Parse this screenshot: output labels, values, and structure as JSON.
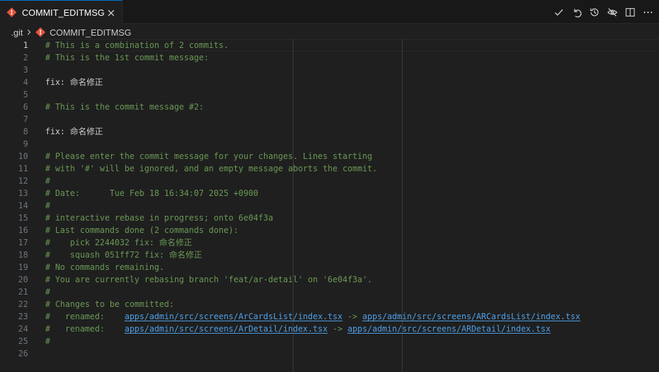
{
  "tab": {
    "title": "COMMIT_EDITMSG"
  },
  "breadcrumb": {
    "folder": ".git",
    "file": "COMMIT_EDITMSG"
  },
  "colors": {
    "accent": "#0078d4",
    "comment": "#6a9955",
    "link": "#4da0e8",
    "git": "#e5533c"
  },
  "actions": [
    {
      "icon": "check-icon"
    },
    {
      "icon": "undo-icon"
    },
    {
      "icon": "history-icon"
    },
    {
      "icon": "eye-closed-icon"
    },
    {
      "icon": "split-editor-icon"
    },
    {
      "icon": "more-icon"
    }
  ],
  "editor": {
    "lines": [
      {
        "num": "1",
        "text": "# This is a combination of 2 commits.",
        "kind": "comment"
      },
      {
        "num": "2",
        "text": "# This is the 1st commit message:",
        "kind": "comment"
      },
      {
        "num": "3",
        "text": "",
        "kind": "plain"
      },
      {
        "num": "4",
        "text": "fix: 命名修正",
        "kind": "plain"
      },
      {
        "num": "5",
        "text": "",
        "kind": "plain"
      },
      {
        "num": "6",
        "text": "# This is the commit message #2:",
        "kind": "comment"
      },
      {
        "num": "7",
        "text": "",
        "kind": "plain"
      },
      {
        "num": "8",
        "text": "fix: 命名修正",
        "kind": "plain"
      },
      {
        "num": "9",
        "text": "",
        "kind": "plain"
      },
      {
        "num": "10",
        "text": "# Please enter the commit message for your changes. Lines starting",
        "kind": "comment"
      },
      {
        "num": "11",
        "text": "# with '#' will be ignored, and an empty message aborts the commit.",
        "kind": "comment"
      },
      {
        "num": "12",
        "text": "#",
        "kind": "comment"
      },
      {
        "num": "13",
        "text": "# Date:      Tue Feb 18 16:34:07 2025 +0900",
        "kind": "comment"
      },
      {
        "num": "14",
        "text": "#",
        "kind": "comment"
      },
      {
        "num": "15",
        "text": "# interactive rebase in progress; onto 6e04f3a",
        "kind": "comment"
      },
      {
        "num": "16",
        "text": "# Last commands done (2 commands done):",
        "kind": "comment"
      },
      {
        "num": "17",
        "text": "#    pick 2244032 fix: 命名修正",
        "kind": "comment"
      },
      {
        "num": "18",
        "text": "#    squash 051ff72 fix: 命名修正",
        "kind": "comment"
      },
      {
        "num": "19",
        "text": "# No commands remaining.",
        "kind": "comment"
      },
      {
        "num": "20",
        "text": "# You are currently rebasing branch 'feat/ar-detail' on '6e04f3a'.",
        "kind": "comment"
      },
      {
        "num": "21",
        "text": "#",
        "kind": "comment"
      },
      {
        "num": "22",
        "text": "# Changes to be committed:",
        "kind": "comment"
      },
      {
        "num": "23",
        "kind": "rename",
        "prefix": "#   renamed:    ",
        "from": "apps/admin/src/screens/ArCardsList/index.tsx",
        "arrow": " -> ",
        "to": "apps/admin/src/screens/ARCardsList/index.tsx"
      },
      {
        "num": "24",
        "kind": "rename",
        "prefix": "#   renamed:    ",
        "from": "apps/admin/src/screens/ArDetail/index.tsx",
        "arrow": " -> ",
        "to": "apps/admin/src/screens/ARDetail/index.tsx"
      },
      {
        "num": "25",
        "text": "#",
        "kind": "comment"
      },
      {
        "num": "26",
        "text": "",
        "kind": "plain"
      }
    ]
  }
}
